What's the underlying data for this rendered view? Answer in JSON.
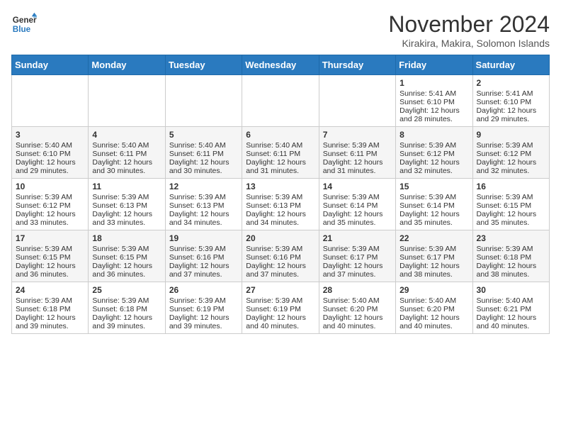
{
  "header": {
    "logo_line1": "General",
    "logo_line2": "Blue",
    "month_title": "November 2024",
    "location": "Kirakira, Makira, Solomon Islands"
  },
  "days_of_week": [
    "Sunday",
    "Monday",
    "Tuesday",
    "Wednesday",
    "Thursday",
    "Friday",
    "Saturday"
  ],
  "weeks": [
    [
      {
        "day": "",
        "info": ""
      },
      {
        "day": "",
        "info": ""
      },
      {
        "day": "",
        "info": ""
      },
      {
        "day": "",
        "info": ""
      },
      {
        "day": "",
        "info": ""
      },
      {
        "day": "1",
        "info": "Sunrise: 5:41 AM\nSunset: 6:10 PM\nDaylight: 12 hours and 28 minutes."
      },
      {
        "day": "2",
        "info": "Sunrise: 5:41 AM\nSunset: 6:10 PM\nDaylight: 12 hours and 29 minutes."
      }
    ],
    [
      {
        "day": "3",
        "info": "Sunrise: 5:40 AM\nSunset: 6:10 PM\nDaylight: 12 hours and 29 minutes."
      },
      {
        "day": "4",
        "info": "Sunrise: 5:40 AM\nSunset: 6:11 PM\nDaylight: 12 hours and 30 minutes."
      },
      {
        "day": "5",
        "info": "Sunrise: 5:40 AM\nSunset: 6:11 PM\nDaylight: 12 hours and 30 minutes."
      },
      {
        "day": "6",
        "info": "Sunrise: 5:40 AM\nSunset: 6:11 PM\nDaylight: 12 hours and 31 minutes."
      },
      {
        "day": "7",
        "info": "Sunrise: 5:39 AM\nSunset: 6:11 PM\nDaylight: 12 hours and 31 minutes."
      },
      {
        "day": "8",
        "info": "Sunrise: 5:39 AM\nSunset: 6:12 PM\nDaylight: 12 hours and 32 minutes."
      },
      {
        "day": "9",
        "info": "Sunrise: 5:39 AM\nSunset: 6:12 PM\nDaylight: 12 hours and 32 minutes."
      }
    ],
    [
      {
        "day": "10",
        "info": "Sunrise: 5:39 AM\nSunset: 6:12 PM\nDaylight: 12 hours and 33 minutes."
      },
      {
        "day": "11",
        "info": "Sunrise: 5:39 AM\nSunset: 6:13 PM\nDaylight: 12 hours and 33 minutes."
      },
      {
        "day": "12",
        "info": "Sunrise: 5:39 AM\nSunset: 6:13 PM\nDaylight: 12 hours and 34 minutes."
      },
      {
        "day": "13",
        "info": "Sunrise: 5:39 AM\nSunset: 6:13 PM\nDaylight: 12 hours and 34 minutes."
      },
      {
        "day": "14",
        "info": "Sunrise: 5:39 AM\nSunset: 6:14 PM\nDaylight: 12 hours and 35 minutes."
      },
      {
        "day": "15",
        "info": "Sunrise: 5:39 AM\nSunset: 6:14 PM\nDaylight: 12 hours and 35 minutes."
      },
      {
        "day": "16",
        "info": "Sunrise: 5:39 AM\nSunset: 6:15 PM\nDaylight: 12 hours and 35 minutes."
      }
    ],
    [
      {
        "day": "17",
        "info": "Sunrise: 5:39 AM\nSunset: 6:15 PM\nDaylight: 12 hours and 36 minutes."
      },
      {
        "day": "18",
        "info": "Sunrise: 5:39 AM\nSunset: 6:15 PM\nDaylight: 12 hours and 36 minutes."
      },
      {
        "day": "19",
        "info": "Sunrise: 5:39 AM\nSunset: 6:16 PM\nDaylight: 12 hours and 37 minutes."
      },
      {
        "day": "20",
        "info": "Sunrise: 5:39 AM\nSunset: 6:16 PM\nDaylight: 12 hours and 37 minutes."
      },
      {
        "day": "21",
        "info": "Sunrise: 5:39 AM\nSunset: 6:17 PM\nDaylight: 12 hours and 37 minutes."
      },
      {
        "day": "22",
        "info": "Sunrise: 5:39 AM\nSunset: 6:17 PM\nDaylight: 12 hours and 38 minutes."
      },
      {
        "day": "23",
        "info": "Sunrise: 5:39 AM\nSunset: 6:18 PM\nDaylight: 12 hours and 38 minutes."
      }
    ],
    [
      {
        "day": "24",
        "info": "Sunrise: 5:39 AM\nSunset: 6:18 PM\nDaylight: 12 hours and 39 minutes."
      },
      {
        "day": "25",
        "info": "Sunrise: 5:39 AM\nSunset: 6:18 PM\nDaylight: 12 hours and 39 minutes."
      },
      {
        "day": "26",
        "info": "Sunrise: 5:39 AM\nSunset: 6:19 PM\nDaylight: 12 hours and 39 minutes."
      },
      {
        "day": "27",
        "info": "Sunrise: 5:39 AM\nSunset: 6:19 PM\nDaylight: 12 hours and 40 minutes."
      },
      {
        "day": "28",
        "info": "Sunrise: 5:40 AM\nSunset: 6:20 PM\nDaylight: 12 hours and 40 minutes."
      },
      {
        "day": "29",
        "info": "Sunrise: 5:40 AM\nSunset: 6:20 PM\nDaylight: 12 hours and 40 minutes."
      },
      {
        "day": "30",
        "info": "Sunrise: 5:40 AM\nSunset: 6:21 PM\nDaylight: 12 hours and 40 minutes."
      }
    ]
  ]
}
